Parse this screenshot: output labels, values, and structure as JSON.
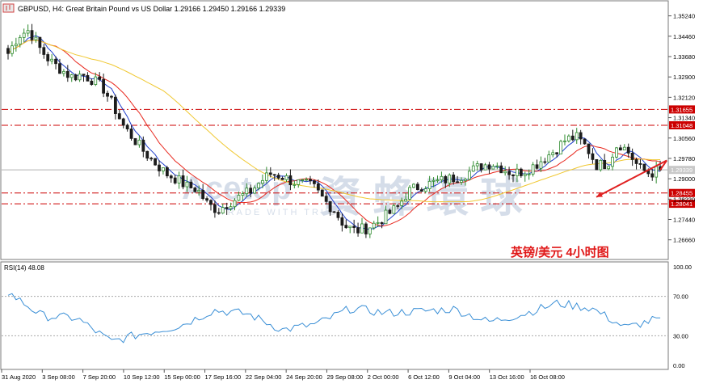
{
  "header": {
    "icon": "chart-icon",
    "symbol_info": "GBPUSD, H4:  Great Britain Pound vs US Dollar  1.29166 1.29450 1.29166 1.29339"
  },
  "annotation_cn": "英镑/美元  4小时图",
  "watermark": {
    "brand": "Acetop",
    "cn": "資 蜂 環 球",
    "sub": "TRADE WITH TRUST"
  },
  "colors": {
    "bull": "#2e8b2e",
    "bear": "#1c1c1c",
    "ma_fast": "#1f3fcc",
    "ma_mid": "#e8281e",
    "ma_slow": "#f0c832",
    "level_line": "#cc0000",
    "level_label_bg": "#cc0000",
    "rsi_line": "#3a8fd6",
    "arrow": "#e02020"
  },
  "chart_data": [
    {
      "type": "candlestick",
      "title": "GBPUSD, H4",
      "ylim": [
        1.26,
        1.356
      ],
      "yticks": [
        "1.35240",
        "1.34460",
        "1.33680",
        "1.32900",
        "1.32120",
        "1.31340",
        "1.30560",
        "1.29780",
        "1.29000",
        "1.28220",
        "1.27440",
        "1.26660"
      ],
      "xticks": [
        "31 Aug 2020",
        "3 Sep 08:00",
        "7 Sep 20:00",
        "10 Sep 12:00",
        "15 Sep 00:00",
        "17 Sep 16:00",
        "22 Sep 04:00",
        "24 Sep 20:00",
        "29 Sep 08:00",
        "2 Oct 00:00",
        "6 Oct 12:00",
        "9 Oct 04:00",
        "13 Oct 16:00",
        "16 Oct 08:00"
      ],
      "last_price": "1.29339",
      "levels": [
        {
          "label": "1.31655",
          "value": 1.31655
        },
        {
          "label": "1.31048",
          "value": 1.31048
        },
        {
          "label": "1.28455",
          "value": 1.28455
        },
        {
          "label": "1.28041",
          "value": 1.28041
        }
      ],
      "close_path": [
        1.338,
        1.345,
        1.347,
        1.34,
        1.335,
        1.332,
        1.329,
        1.33,
        1.328,
        1.325,
        1.318,
        1.31,
        1.305,
        1.3,
        1.296,
        1.292,
        1.29,
        1.287,
        1.286,
        1.28,
        1.278,
        1.281,
        1.283,
        1.285,
        1.289,
        1.292,
        1.291,
        1.289,
        1.288,
        1.287,
        1.282,
        1.278,
        1.272,
        1.27,
        1.271,
        1.273,
        1.276,
        1.279,
        1.285,
        1.287,
        1.288,
        1.289,
        1.29,
        1.291,
        1.293,
        1.295,
        1.296,
        1.294,
        1.292,
        1.293,
        1.295,
        1.298,
        1.301,
        1.305,
        1.306,
        1.302,
        1.295,
        1.296,
        1.304,
        1.3,
        1.294,
        1.292,
        1.2934
      ],
      "forecast": {
        "from": 1.2934,
        "peak": 1.297,
        "to": 1.283
      }
    },
    {
      "type": "line",
      "title": "RSI(14) 48.08",
      "ylim": [
        0,
        100
      ],
      "yticks": [
        "100.00",
        "70.00",
        "30.00",
        "0.00"
      ],
      "levels": [
        70,
        30
      ],
      "x": [
        "31 Aug 2020",
        "3 Sep 08:00",
        "7 Sep 20:00",
        "10 Sep 12:00",
        "15 Sep 00:00",
        "17 Sep 16:00",
        "22 Sep 04:00",
        "24 Sep 20:00",
        "29 Sep 08:00",
        "2 Oct 00:00",
        "6 Oct 12:00",
        "9 Oct 04:00",
        "13 Oct 16:00",
        "16 Oct 08:00"
      ],
      "values": [
        74,
        50,
        48,
        24,
        33,
        40,
        56,
        52,
        36,
        42,
        58,
        53,
        55,
        57,
        44,
        52,
        63,
        58,
        38,
        48
      ]
    }
  ]
}
